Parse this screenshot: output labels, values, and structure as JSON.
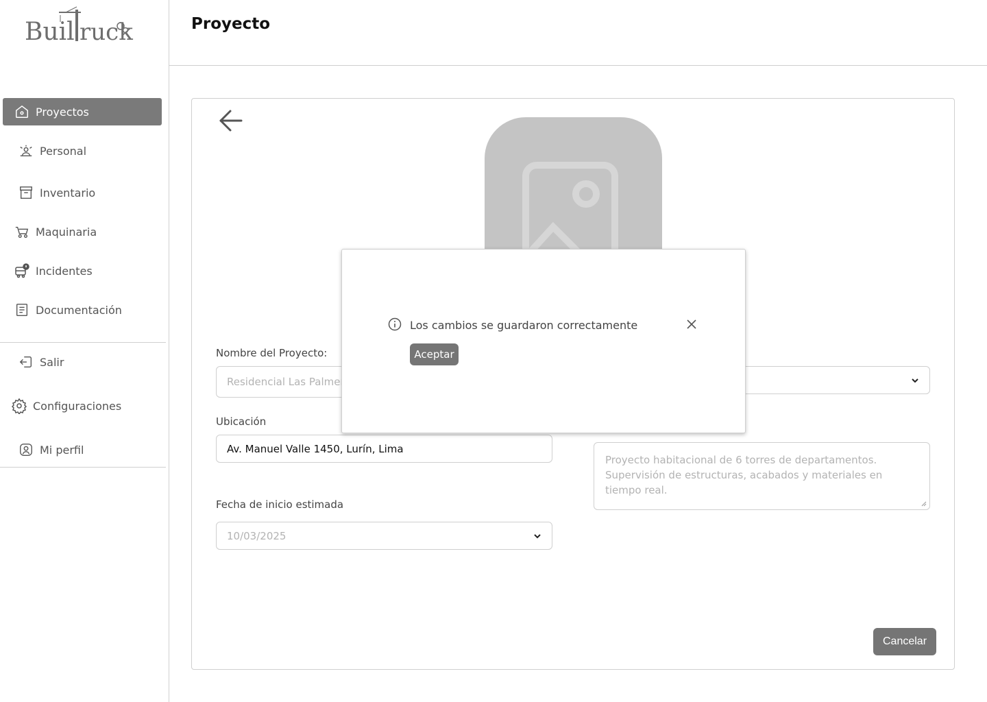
{
  "brand": {
    "name": "BuilTruck"
  },
  "sidebar": {
    "items": [
      {
        "label": "Proyectos",
        "icon": "home-icon",
        "active": true
      },
      {
        "label": "Personal",
        "icon": "people-icon"
      },
      {
        "label": "Inventario",
        "icon": "archive-icon"
      },
      {
        "label": "Maquinaria",
        "icon": "cart-icon"
      },
      {
        "label": "Incidentes",
        "icon": "truck-alert-icon"
      },
      {
        "label": "Documentación",
        "icon": "document-icon"
      }
    ],
    "bottom_items": [
      {
        "label": "Salir",
        "icon": "logout-icon"
      },
      {
        "label": "Configuraciones",
        "icon": "gear-icon"
      },
      {
        "label": "Mi perfil",
        "icon": "user-icon"
      }
    ]
  },
  "header": {
    "title": "Proyecto"
  },
  "form": {
    "name_label": "Nombre del Proyecto:",
    "name_placeholder": "Residencial Las Palmeras",
    "location_label": "Ubicación",
    "location_value": "Av. Manuel Valle 1450, Lurín, Lima",
    "start_date_label": "Fecha de inicio estimada",
    "start_date_value": "10/03/2025",
    "description_placeholder_lines": [
      "Proyecto habitacional de 6 torres de departamentos.",
      "Supervisión de estructuras, acabados y materiales en",
      "tiempo real."
    ],
    "cancel_label": "Cancelar"
  },
  "modal": {
    "message": "Los cambios se guardaron correctamente",
    "accept_label": "Aceptar"
  },
  "colors": {
    "active_nav": "#7a7a7a",
    "button": "#757575",
    "placeholder_image": "#c4c4c4",
    "border": "#cfcfcf"
  }
}
